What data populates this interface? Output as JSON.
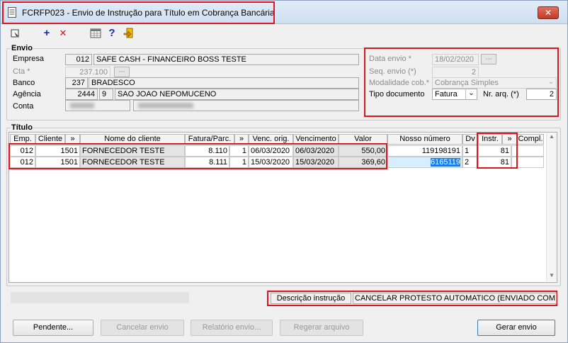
{
  "window": {
    "title": "FCRFP023 - Envio de Instrução para Título em Cobrança Bancária",
    "close_label": "✕"
  },
  "toolbar": {
    "icons": [
      "exit-icon",
      "add-icon",
      "delete-icon",
      "calculator-icon",
      "help-icon",
      "export-icon"
    ],
    "add_label": "+",
    "delete_label": "✕",
    "help_label": "?"
  },
  "envio": {
    "title": "Envio",
    "empresa_label": "Empresa",
    "empresa_code": "012",
    "empresa_name": "SAFE CASH - FINANCEIRO BOSS TESTE",
    "cta_label": "Cta *",
    "cta_value": "237.100",
    "banco_label": "Banco",
    "banco_code": "237",
    "banco_name": "BRADESCO",
    "agencia_label": "Agência",
    "agencia_code": "2444",
    "agencia_dv": "9",
    "agencia_name": "SAO JOAO NEPOMUCENO",
    "conta_label": "Conta",
    "data_envio_label": "Data envio *",
    "data_envio_value": "18/02/2020",
    "seq_envio_label": "Seq. envio (*)",
    "seq_envio_value": "2",
    "modalidade_label": "Modalidade cob.*",
    "modalidade_value": "Cobrança Simples",
    "tipo_doc_label": "Tipo documento",
    "tipo_doc_value": "Fatura",
    "nr_arq_label": "Nr. arq. (*)",
    "nr_arq_value": "2"
  },
  "titulo": {
    "title": "Título",
    "columns": [
      "Emp.",
      "Cliente",
      "»",
      "Nome do cliente",
      "Fatura/Parc.",
      "»",
      "Venc. orig.",
      "Vencimento",
      "Valor",
      "Nosso número",
      "Dv",
      "Instr.",
      "»",
      "Compl."
    ],
    "rows": [
      {
        "emp": "012",
        "cliente": "1501",
        "nome": "FORNECEDOR TESTE",
        "fatura": "8.110",
        "parc": "1",
        "venc_orig": "06/03/2020",
        "vencimento": "06/03/2020",
        "valor": "550,00",
        "nosso_numero": "119198191",
        "dv": "1",
        "instr": "81"
      },
      {
        "emp": "012",
        "cliente": "1501",
        "nome": "FORNECEDOR TESTE",
        "fatura": "8.111",
        "parc": "1",
        "venc_orig": "15/03/2020",
        "vencimento": "15/03/2020",
        "valor": "369,60",
        "nosso_numero": "6165119",
        "dv": "2",
        "instr": "81"
      }
    ]
  },
  "descricao": {
    "label": "Descrição instrução",
    "value": "CANCELAR PROTESTO AUTOMATICO (ENVIADO COM OCORRENCIA)"
  },
  "buttons": {
    "pendente": "Pendente...",
    "cancelar_envio": "Cancelar envio",
    "relatorio_envio": "Relatório envio...",
    "regerar_arquivo": "Regerar arquivo",
    "gerar_envio": "Gerar envio"
  },
  "colors": {
    "highlight_border": "#e0141c",
    "selection": "#1c7de1",
    "titlebar": "#cfdff2"
  }
}
